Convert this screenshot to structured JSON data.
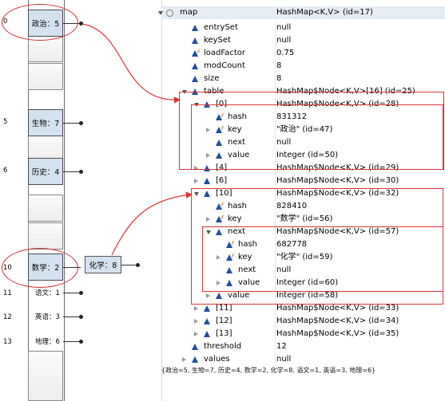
{
  "hash_table": {
    "slots": [
      {
        "index": "0",
        "label": "政治：5"
      },
      {
        "index": "5",
        "label": "生物：7"
      },
      {
        "index": "6",
        "label": "历史：4"
      },
      {
        "index": "10",
        "label": "数学：2"
      },
      {
        "index": "11",
        "label": "语文：1"
      },
      {
        "index": "12",
        "label": "英语：3"
      },
      {
        "index": "13",
        "label": "地理：6"
      }
    ],
    "chained_node": "化学：8"
  },
  "tree": {
    "rows": [
      {
        "name": "map",
        "value": "HashMap<K,V>  (id=17)"
      },
      {
        "name": "entrySet",
        "value": "null"
      },
      {
        "name": "keySet",
        "value": "null"
      },
      {
        "name": "loadFactor",
        "value": "0.75"
      },
      {
        "name": "modCount",
        "value": "8"
      },
      {
        "name": "size",
        "value": "8"
      },
      {
        "name": "table",
        "value": "HashMap$Node<K,V>[16]  (id=25)"
      },
      {
        "name": "[0]",
        "value": "HashMap$Node<K,V>  (id=28)"
      },
      {
        "name": "hash",
        "value": "831312"
      },
      {
        "name": "key",
        "value": "\"政治\" (id=47)"
      },
      {
        "name": "next",
        "value": "null"
      },
      {
        "name": "value",
        "value": "Integer  (id=50)"
      },
      {
        "name": "[4]",
        "value": "HashMap$Node<K,V>  (id=29)"
      },
      {
        "name": "[6]",
        "value": "HashMap$Node<K,V>  (id=30)"
      },
      {
        "name": "[10]",
        "value": "HashMap$Node<K,V>  (id=32)"
      },
      {
        "name": "hash",
        "value": "828410"
      },
      {
        "name": "key",
        "value": "\"数学\" (id=56)"
      },
      {
        "name": "next",
        "value": "HashMap$Node<K,V>  (id=57)"
      },
      {
        "name": "hash",
        "value": "682778"
      },
      {
        "name": "key",
        "value": "\"化学\" (id=59)"
      },
      {
        "name": "next",
        "value": "null"
      },
      {
        "name": "value",
        "value": "Integer  (id=60)"
      },
      {
        "name": "value",
        "value": "Integer  (id=58)"
      },
      {
        "name": "[11]",
        "value": "HashMap$Node<K,V>  (id=33)"
      },
      {
        "name": "[12]",
        "value": "HashMap$Node<K,V>  (id=34)"
      },
      {
        "name": "[13]",
        "value": "HashMap$Node<K,V>  (id=35)"
      },
      {
        "name": "threshold",
        "value": "12"
      },
      {
        "name": "values",
        "value": "null"
      }
    ]
  },
  "status_text": "{政治=5, 生物=7, 历史=4, 数学=2, 化学=8, 语文=1, 英语=3, 地理=6}",
  "colors": {
    "accent_red": "#e03333",
    "slot_fill": "#d4e2ef",
    "field_icon": "#1e4fa0"
  }
}
